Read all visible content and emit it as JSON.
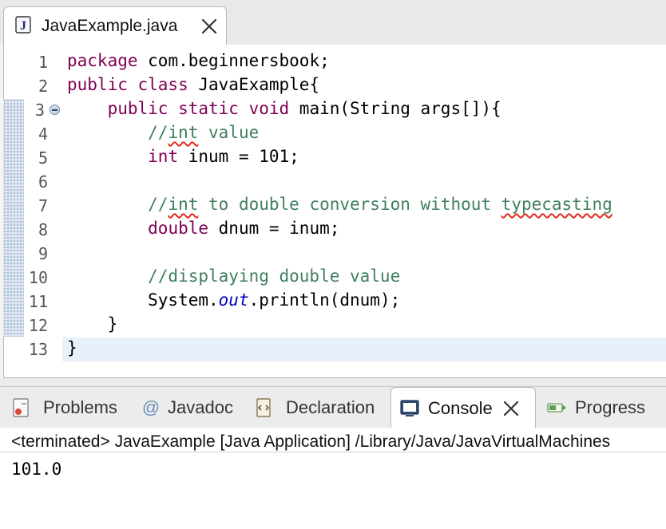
{
  "editor": {
    "tab_title": "JavaExample.java",
    "tab_icon": "java-file-icon",
    "line_numbers": [
      "1",
      "2",
      "3",
      "4",
      "5",
      "6",
      "7",
      "8",
      "9",
      "10",
      "11",
      "12",
      "13"
    ],
    "lines": [
      [
        "package",
        " com.beginnersbook;"
      ],
      [
        "public class",
        " JavaExample{"
      ],
      [
        "    ",
        "public static void",
        " main(String args[]){"
      ],
      [
        "        //",
        "int",
        " value"
      ],
      [
        "        ",
        "int",
        " inum = 101;"
      ],
      [
        ""
      ],
      [
        "        //",
        "int",
        " to double conversion without ",
        "typecasting"
      ],
      [
        "        ",
        "double",
        " dnum = inum;"
      ],
      [
        ""
      ],
      [
        "        //displaying double value"
      ],
      [
        "        System.",
        "out",
        ".println(dnum);"
      ],
      [
        "    }"
      ],
      [
        "}"
      ]
    ]
  },
  "views": {
    "tabs": [
      {
        "label": "Problems",
        "icon": "problems-icon"
      },
      {
        "label": "Javadoc",
        "icon": "at-sign-icon"
      },
      {
        "label": "Declaration",
        "icon": "declaration-icon"
      },
      {
        "label": "Console",
        "icon": "console-icon",
        "active": true
      },
      {
        "label": "Progress",
        "icon": "progress-icon"
      }
    ]
  },
  "console": {
    "status": "<terminated> JavaExample [Java Application] /Library/Java/JavaVirtualMachines",
    "output": "101.0"
  },
  "colors": {
    "keyword": "#7f0055",
    "comment": "#3f7f5f",
    "field": "#0000c0"
  }
}
